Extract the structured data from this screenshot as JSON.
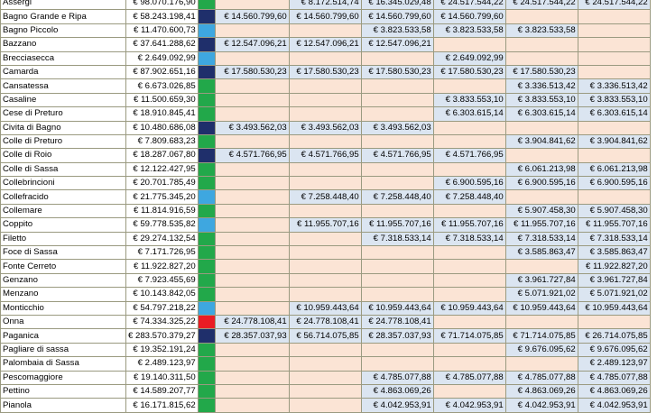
{
  "colors": {
    "dark": "#1f2f6b",
    "blue": "#3ea7e0",
    "green": "#22a84a",
    "red": "#ea1c24",
    "empty": "#fbe4d5",
    "filled": "#dbe5f1"
  },
  "rows": [
    {
      "name": "Assergi",
      "total": "€ 98.070.176,90",
      "color": "green",
      "vals": [
        "",
        "€ 8.172.514,74",
        "€ 16.345.029,48",
        "€ 24.517.544,22",
        "€ 24.517.544,22",
        "€ 24.517.544,22"
      ]
    },
    {
      "name": "Bagno Grande e Ripa",
      "total": "€ 58.243.198,41",
      "color": "dark",
      "vals": [
        "€ 14.560.799,60",
        "€ 14.560.799,60",
        "€ 14.560.799,60",
        "€ 14.560.799,60",
        "",
        ""
      ]
    },
    {
      "name": "Bagno Piccolo",
      "total": "€ 11.470.600,73",
      "color": "blue",
      "vals": [
        "",
        "",
        "€ 3.823.533,58",
        "€ 3.823.533,58",
        "€ 3.823.533,58",
        ""
      ]
    },
    {
      "name": "Bazzano",
      "total": "€ 37.641.288,62",
      "color": "dark",
      "vals": [
        "€ 12.547.096,21",
        "€ 12.547.096,21",
        "€ 12.547.096,21",
        "",
        "",
        ""
      ]
    },
    {
      "name": "Brecciasecca",
      "total": "€ 2.649.092,99",
      "color": "blue",
      "vals": [
        "",
        "",
        "",
        "€ 2.649.092,99",
        "",
        ""
      ]
    },
    {
      "name": "Camarda",
      "total": "€ 87.902.651,16",
      "color": "dark",
      "vals": [
        "€ 17.580.530,23",
        "€ 17.580.530,23",
        "€ 17.580.530,23",
        "€ 17.580.530,23",
        "€ 17.580.530,23",
        ""
      ]
    },
    {
      "name": "Cansatessa",
      "total": "€ 6.673.026,85",
      "color": "green",
      "vals": [
        "",
        "",
        "",
        "",
        "€ 3.336.513,42",
        "€ 3.336.513,42"
      ]
    },
    {
      "name": "Casaline",
      "total": "€ 11.500.659,30",
      "color": "green",
      "vals": [
        "",
        "",
        "",
        "€ 3.833.553,10",
        "€ 3.833.553,10",
        "€ 3.833.553,10"
      ]
    },
    {
      "name": "Cese di Preturo",
      "total": "€ 18.910.845,41",
      "color": "green",
      "vals": [
        "",
        "",
        "",
        "€ 6.303.615,14",
        "€ 6.303.615,14",
        "€ 6.303.615,14"
      ]
    },
    {
      "name": "Civita di Bagno",
      "total": "€ 10.480.686,08",
      "color": "dark",
      "vals": [
        "€ 3.493.562,03",
        "€ 3.493.562,03",
        "€ 3.493.562,03",
        "",
        "",
        ""
      ]
    },
    {
      "name": "Colle di Preturo",
      "total": "€ 7.809.683,23",
      "color": "green",
      "vals": [
        "",
        "",
        "",
        "",
        "€ 3.904.841,62",
        "€ 3.904.841,62"
      ]
    },
    {
      "name": "Colle di Roio",
      "total": "€ 18.287.067,80",
      "color": "dark",
      "vals": [
        "€ 4.571.766,95",
        "€ 4.571.766,95",
        "€ 4.571.766,95",
        "€ 4.571.766,95",
        "",
        ""
      ]
    },
    {
      "name": "Colle di Sassa",
      "total": "€ 12.122.427,95",
      "color": "green",
      "vals": [
        "",
        "",
        "",
        "",
        "€ 6.061.213,98",
        "€ 6.061.213,98"
      ]
    },
    {
      "name": "Collebrincioni",
      "total": "€ 20.701.785,49",
      "color": "green",
      "vals": [
        "",
        "",
        "",
        "€ 6.900.595,16",
        "€ 6.900.595,16",
        "€ 6.900.595,16"
      ]
    },
    {
      "name": "Collefracido",
      "total": "€ 21.775.345,20",
      "color": "blue",
      "vals": [
        "",
        "€ 7.258.448,40",
        "€ 7.258.448,40",
        "€ 7.258.448,40",
        "",
        ""
      ]
    },
    {
      "name": "Collemare",
      "total": "€ 11.814.916,59",
      "color": "green",
      "vals": [
        "",
        "",
        "",
        "",
        "€ 5.907.458,30",
        "€ 5.907.458,30"
      ]
    },
    {
      "name": "Coppito",
      "total": "€ 59.778.535,82",
      "color": "blue",
      "vals": [
        "",
        "€ 11.955.707,16",
        "€ 11.955.707,16",
        "€ 11.955.707,16",
        "€ 11.955.707,16",
        "€ 11.955.707,16"
      ]
    },
    {
      "name": "Filetto",
      "total": "€ 29.274.132,54",
      "color": "green",
      "vals": [
        "",
        "",
        "€ 7.318.533,14",
        "€ 7.318.533,14",
        "€ 7.318.533,14",
        "€ 7.318.533,14"
      ]
    },
    {
      "name": "Foce di Sassa",
      "total": "€ 7.171.726,95",
      "color": "green",
      "vals": [
        "",
        "",
        "",
        "",
        "€ 3.585.863,47",
        "€ 3.585.863,47"
      ]
    },
    {
      "name": "Fonte Cerreto",
      "total": "€ 11.922.827,20",
      "color": "green",
      "vals": [
        "",
        "",
        "",
        "",
        "",
        "€ 11.922.827,20"
      ]
    },
    {
      "name": "Genzano",
      "total": "€ 7.923.455,69",
      "color": "green",
      "vals": [
        "",
        "",
        "",
        "",
        "€ 3.961.727,84",
        "€ 3.961.727,84"
      ]
    },
    {
      "name": "Menzano",
      "total": "€ 10.143.842,05",
      "color": "green",
      "vals": [
        "",
        "",
        "",
        "",
        "€ 5.071.921,02",
        "€ 5.071.921,02"
      ]
    },
    {
      "name": "Monticchio",
      "total": "€ 54.797.218,22",
      "color": "blue",
      "vals": [
        "",
        "€ 10.959.443,64",
        "€ 10.959.443,64",
        "€ 10.959.443,64",
        "€ 10.959.443,64",
        "€ 10.959.443,64"
      ]
    },
    {
      "name": "Onna",
      "total": "€ 74.334.325,22",
      "color": "red",
      "vals": [
        "€ 24.778.108,41",
        "€ 24.778.108,41",
        "€ 24.778.108,41",
        "",
        "",
        ""
      ]
    },
    {
      "name": "Paganica",
      "total": "€ 283.570.379,27",
      "color": "dark",
      "vals": [
        "€ 28.357.037,93",
        "€ 56.714.075,85",
        "€ 28.357.037,93",
        "€ 71.714.075,85",
        "€ 71.714.075,85",
        "€ 26.714.075,85"
      ]
    },
    {
      "name": "Pagliare di sassa",
      "total": "€ 19.352.191,24",
      "color": "green",
      "vals": [
        "",
        "",
        "",
        "",
        "€ 9.676.095,62",
        "€ 9.676.095,62"
      ]
    },
    {
      "name": "Palombaia di Sassa",
      "total": "€ 2.489.123,97",
      "color": "green",
      "vals": [
        "",
        "",
        "",
        "",
        "",
        "€ 2.489.123,97"
      ]
    },
    {
      "name": "Pescomaggiore",
      "total": "€ 19.140.311,50",
      "color": "green",
      "vals": [
        "",
        "",
        "€ 4.785.077,88",
        "€ 4.785.077,88",
        "€ 4.785.077,88",
        "€ 4.785.077,88"
      ]
    },
    {
      "name": "Pettino",
      "total": "€ 14.589.207,77",
      "color": "green",
      "vals": [
        "",
        "",
        "€ 4.863.069,26",
        "",
        "€ 4.863.069,26",
        "€ 4.863.069,26"
      ]
    },
    {
      "name": "Pianola",
      "total": "€ 16.171.815,62",
      "color": "green",
      "vals": [
        "",
        "",
        "€ 4.042.953,91",
        "€ 4.042.953,91",
        "€ 4.042.953,91",
        "€ 4.042.953,91"
      ]
    }
  ]
}
